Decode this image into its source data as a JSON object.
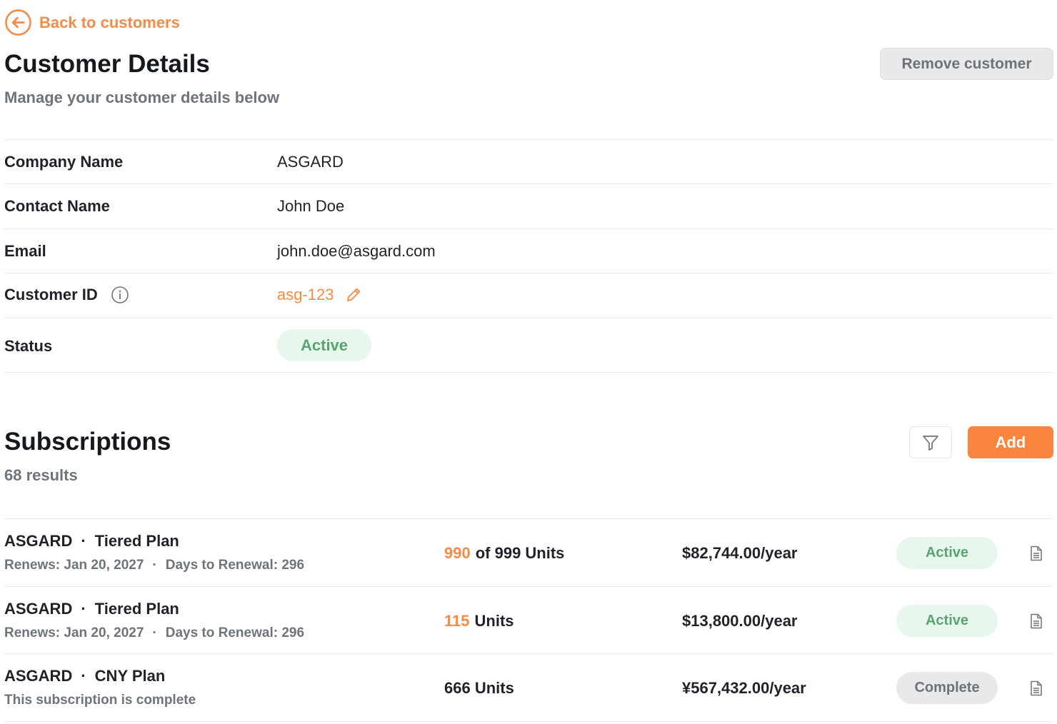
{
  "nav": {
    "back_label": "Back to customers"
  },
  "header": {
    "title": "Customer Details",
    "subtitle": "Manage your customer details below",
    "remove_label": "Remove customer"
  },
  "details": {
    "company_label": "Company Name",
    "company_value": "ASGARD",
    "contact_label": "Contact Name",
    "contact_value": "John Doe",
    "email_label": "Email",
    "email_value": "john.doe@asgard.com",
    "customer_id_label": "Customer ID",
    "customer_id_value": "asg-123",
    "status_label": "Status",
    "status_value": "Active"
  },
  "subscriptions": {
    "title": "Subscriptions",
    "count": "68 results",
    "add_label": "Add",
    "items": [
      {
        "company": "ASGARD",
        "plan": "Tiered Plan",
        "renews": "Renews: Jan 20, 2027",
        "days": "Days to Renewal: 296",
        "units_used": "990",
        "units_rest": "of 999 Units",
        "price": "$82,744.00/year",
        "status": "Active"
      },
      {
        "company": "ASGARD",
        "plan": "Tiered Plan",
        "renews": "Renews: Jan 20, 2027",
        "days": "Days to Renewal: 296",
        "units_used": "115",
        "units_rest": "Units",
        "price": "$13,800.00/year",
        "status": "Active"
      },
      {
        "company": "ASGARD",
        "plan": "CNY Plan",
        "note": "This subscription is complete",
        "units": "666 Units",
        "price": "¥567,432.00/year",
        "status": "Complete"
      }
    ]
  },
  "colors": {
    "accent": "#f58b45",
    "active_bg": "#e8f7ed",
    "active_text": "#5aa472",
    "neutral_bg": "#e8e9ea",
    "muted_text": "#6f747a"
  },
  "icons": {
    "back": "arrow-left-circle-icon",
    "info": "info-icon",
    "edit": "pencil-icon",
    "filter": "filter-icon",
    "document": "document-icon"
  }
}
